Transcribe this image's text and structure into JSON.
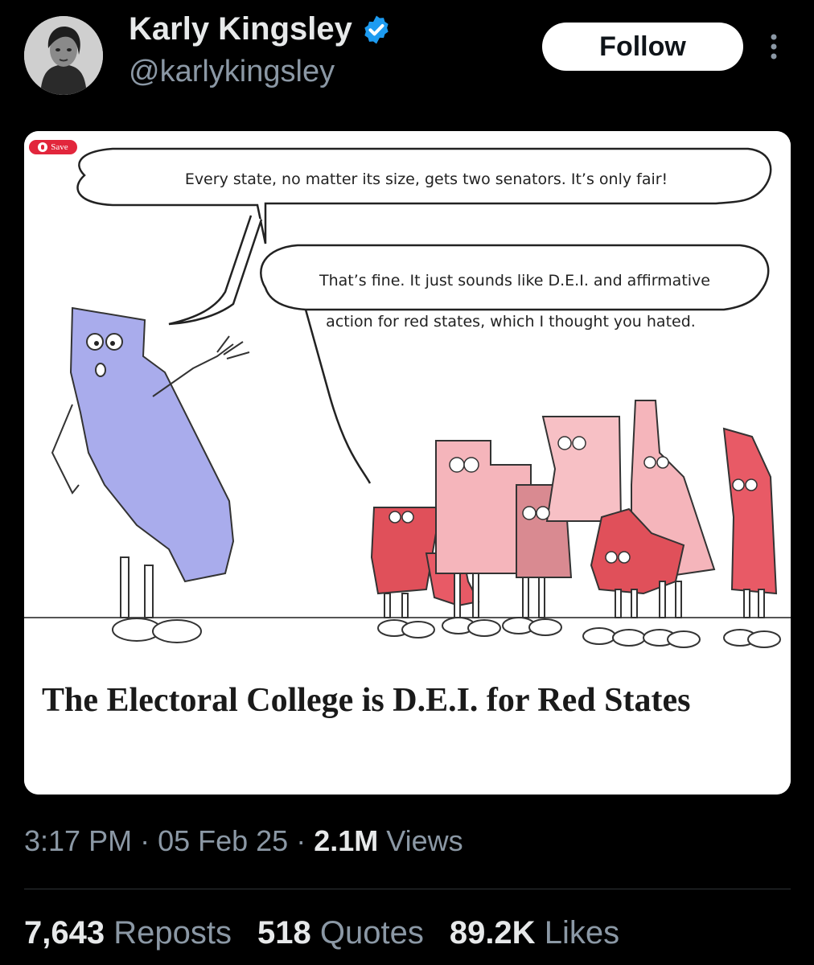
{
  "header": {
    "display_name": "Karly Kingsley",
    "handle": "@karlykingsley",
    "follow_label": "Follow",
    "verified": true,
    "avatar_icon": "avatar-photo",
    "more_icon": "more-options-icon"
  },
  "image": {
    "save_label": "Save",
    "bubble_1": "Every state, no matter its size, gets two senators. It’s only fair!",
    "bubble_2_line_1": "That’s fine. It just sounds like D.E.I. and affirmative",
    "bubble_2_line_2": "action for red states, which I thought you hated.",
    "caption": "The Electoral College is D.E.I. for Red States"
  },
  "meta": {
    "time": "3:17 PM",
    "sep1": " · ",
    "date": "05 Feb 25",
    "sep2": " · ",
    "views_count": "2.1M",
    "views_label": " Views"
  },
  "stats": {
    "reposts_count": "7,643",
    "reposts_label": "Reposts",
    "quotes_count": "518",
    "quotes_label": "Quotes",
    "likes_count": "89.2K",
    "likes_label": "Likes"
  },
  "colors": {
    "background": "#000000",
    "verified_blue": "#1d9bf0",
    "muted_text": "#8b98a5",
    "california_blue": "#a9acec",
    "red_state_dark": "#e0505a",
    "red_state_light": "#f2b8bd"
  }
}
